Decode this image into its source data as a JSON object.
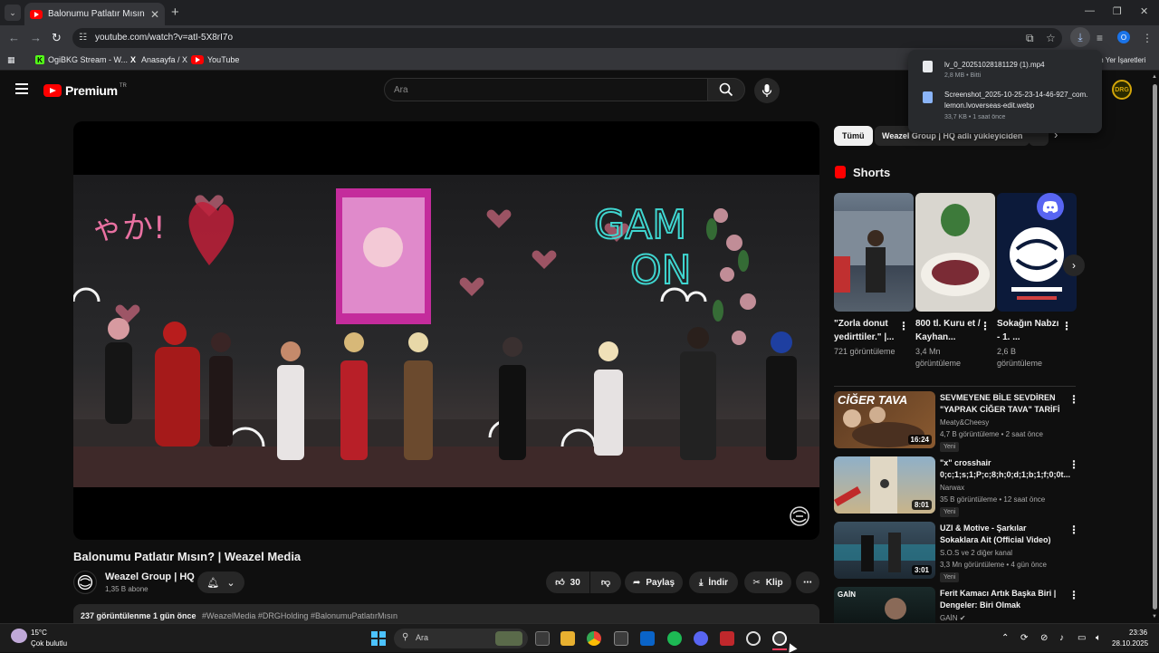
{
  "browser": {
    "tab_title": "Balonumu Patlatır Mısın? | Wea",
    "url": "youtube.com/watch?v=atI-5X8rI7o",
    "bookmarks": [
      {
        "label": "OgiBKG Stream - W..."
      },
      {
        "label": "Anasayfa / X"
      },
      {
        "label": "YouTube"
      }
    ],
    "bookmarks_trailing": "m Yer İşaretleri",
    "profile_initial": "O"
  },
  "downloads": [
    {
      "name": "lv_0_20251028181129 (1).mp4",
      "meta": "2,8 MB • Bitti"
    },
    {
      "name": "Screenshot_2025-10-25-23-14-46-927_com.lemon.lvoverseas-edit.webp",
      "meta": "33,7 KB • 1 saat önce"
    }
  ],
  "youtube": {
    "logo_text": "Premium",
    "logo_region": "TR",
    "search_placeholder": "Ara"
  },
  "video": {
    "title": "Balonumu Patlatır Mısın? | Weazel Media",
    "channel": "Weazel Group | HQ",
    "subscribers": "1,35 B abone",
    "likes": "30",
    "share_label": "Paylaş",
    "download_label": "İndir",
    "clip_label": "Klip",
    "description_stats": "237 görüntülenme  1 gün önce",
    "description_tags": "#WeazelMedia #DRGHolding #BalonumuPatlatırMısın"
  },
  "chips": [
    "Tümü",
    "Weazel Group | HQ adlı yükleyiciden"
  ],
  "shorts": {
    "heading": "Shorts",
    "items": [
      {
        "title": "\"Zorla donut yedirttiler.\" |...",
        "views": "721 görüntüleme"
      },
      {
        "title": "800 tl. Kuru et / Kayhan...",
        "views": "3,4 Mn görüntüleme"
      },
      {
        "title": "Sokağın Nabzı - 1. ...",
        "views": "2,6 B görüntüleme"
      }
    ]
  },
  "recommended": [
    {
      "title": "SEVMEYENE BİLE SEVDİREN \"YAPRAK CİĞER TAVA\" TARİFİ",
      "channel": "Meaty&Cheesy",
      "meta": "4,7 B görüntüleme • 2 saat önce",
      "badge": "Yeni",
      "duration": "16:24",
      "thumb_text": "CİĞER TAVA"
    },
    {
      "title": "\"x\" crosshair 0;c;1;s;1;P;c;8;h;0;d;1;b;1;f;0;0t...",
      "channel": "Narwax",
      "meta": "35 B görüntüleme • 12 saat önce",
      "badge": "Yeni",
      "duration": "8:01",
      "thumb_text": ""
    },
    {
      "title": "UZI & Motive - Şarkılar Sokaklara Ait (Official Video)",
      "channel": "S.O.S ve 2 diğer kanal",
      "meta": "3,3 Mn görüntüleme • 4 gün önce",
      "badge": "Yeni",
      "duration": "3:01",
      "thumb_text": ""
    },
    {
      "title": "Ferit Kamacı Artık Başka Biri | Dengeler: Biri Olmak",
      "channel": "GAİN",
      "meta": "",
      "badge": "",
      "duration": "",
      "thumb_text": "GAİN"
    }
  ],
  "taskbar": {
    "temperature": "15°C",
    "weather": "Çok bulutlu",
    "search_label": "Ara",
    "time": "23:36",
    "date": "28.10.2025"
  }
}
